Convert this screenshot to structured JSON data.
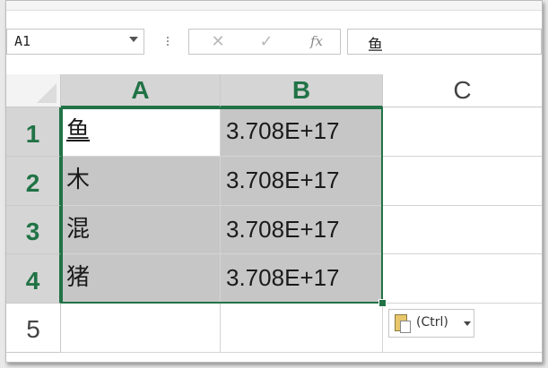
{
  "name_box": {
    "value": "A1"
  },
  "formula_bar": {
    "cancel_symbol": "✕",
    "enter_symbol": "✓",
    "fx_label": "fx",
    "content": "鱼"
  },
  "columns": [
    "A",
    "B",
    "C"
  ],
  "rows": [
    "1",
    "2",
    "3",
    "4",
    "5"
  ],
  "cells": {
    "A1": "鱼",
    "B1": "3.708E+17",
    "A2": "木",
    "B2": "3.708E+17",
    "A3": "混",
    "B3": "3.708E+17",
    "A4": "猪",
    "B4": "3.708E+17"
  },
  "paste_options": {
    "label": "(Ctrl)"
  },
  "colors": {
    "accent": "#217346",
    "selection_fill": "#c6c6c6",
    "header_selected": "#d5d5d5"
  }
}
